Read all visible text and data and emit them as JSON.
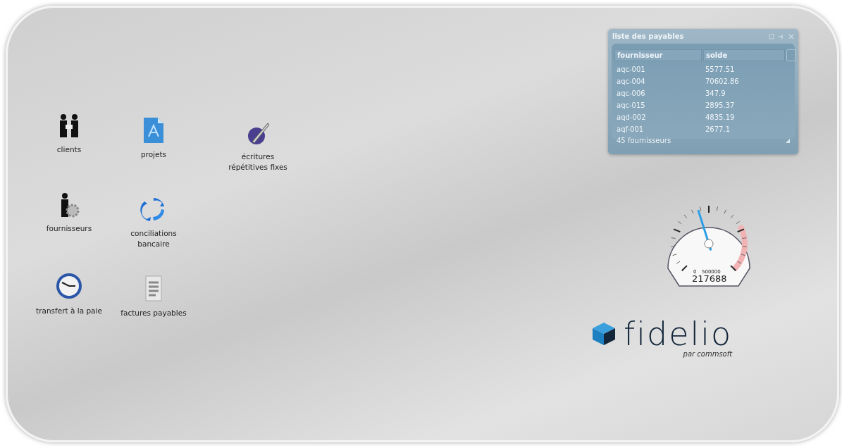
{
  "desktop_icons": [
    {
      "kind": "people",
      "label": "clients"
    },
    {
      "kind": "document",
      "label": "projets"
    },
    {
      "kind": "pen",
      "label": "écritures répétitives fixes"
    },
    {
      "kind": "supplier",
      "label": "fournisseurs"
    },
    {
      "kind": "sync",
      "label": "conciliations bancaire"
    },
    {
      "kind": "clock",
      "label": "transfert à la paie"
    },
    {
      "kind": "invoice",
      "label": "factures payables"
    }
  ],
  "payables_widget": {
    "title": "liste des payables",
    "columns": [
      "fournisseur",
      "solde"
    ],
    "rows": [
      [
        "aqc-001",
        "5577.51"
      ],
      [
        "aqc-004",
        "70602.86"
      ],
      [
        "aqc-006",
        "347.9"
      ],
      [
        "aqc-015",
        "2895.37"
      ],
      [
        "aqd-002",
        "4835.19"
      ],
      [
        "aqf-001",
        "2677.1"
      ]
    ],
    "footer": "45 fournisseurs"
  },
  "gauge": {
    "min_label": "0",
    "max_label": "500000",
    "reading": "217688",
    "level": 0.435
  },
  "logo": {
    "name": "fidelio",
    "tagline": "par commsoft"
  }
}
